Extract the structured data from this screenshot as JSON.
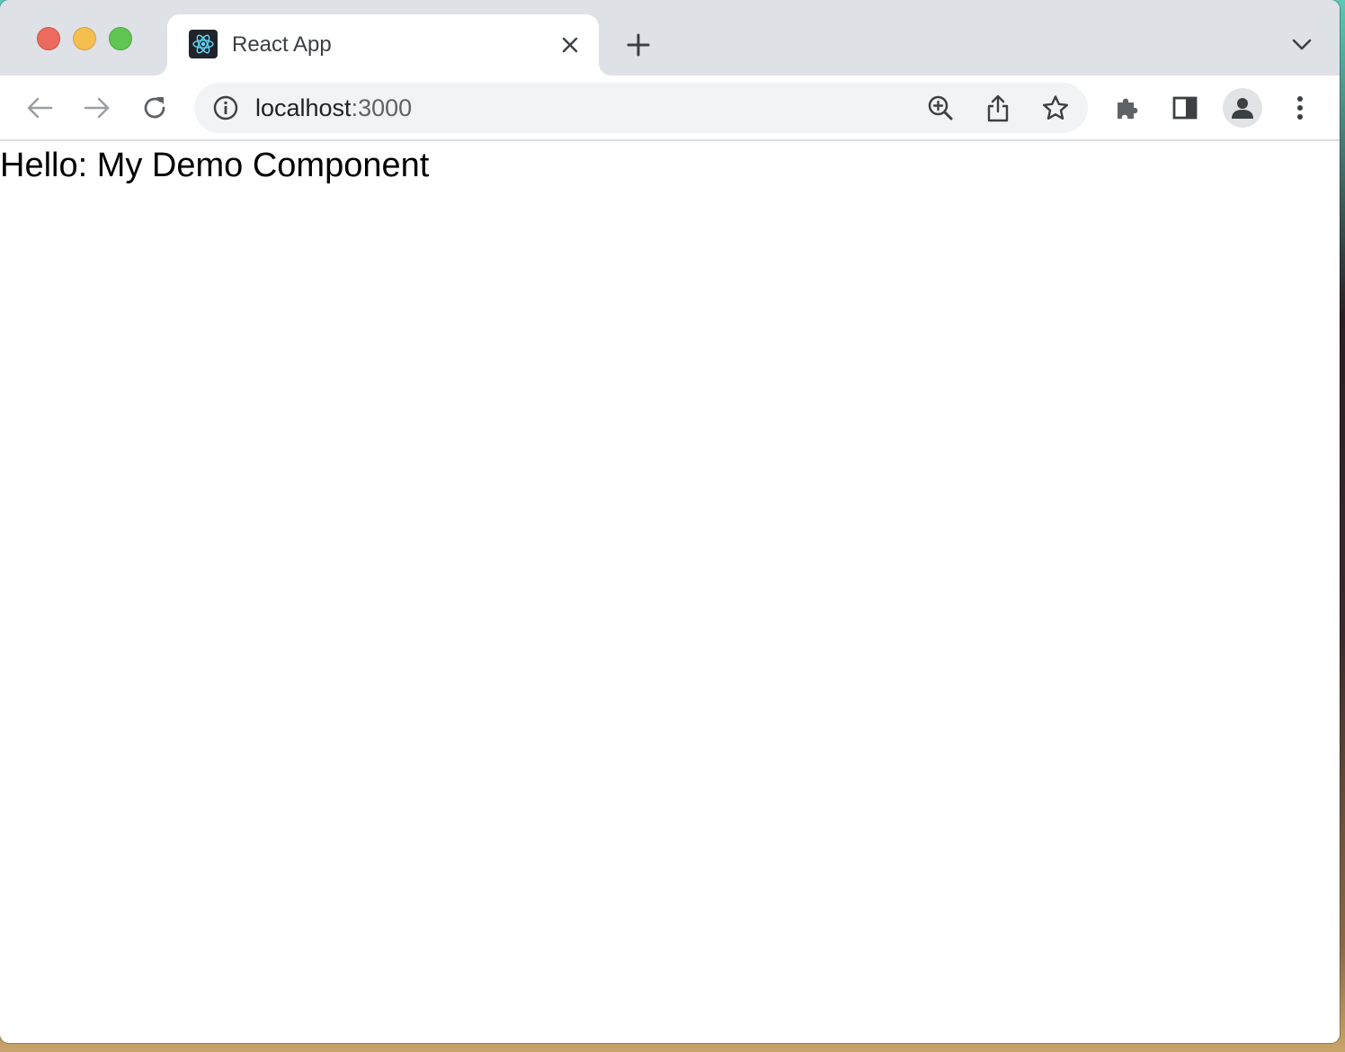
{
  "window": {
    "controls": {
      "close": {
        "color": "#ec6a5e"
      },
      "minimize": {
        "color": "#f4bf4f"
      },
      "zoom": {
        "color": "#61c554"
      }
    }
  },
  "tabs": [
    {
      "title": "React App",
      "favicon": "react-logo-icon",
      "active": true
    }
  ],
  "tab_strip": {
    "new_tab_icon": "plus-icon",
    "tab_search_icon": "chevron-down-icon"
  },
  "toolbar": {
    "back_icon": "arrow-left-icon",
    "forward_icon": "arrow-right-icon",
    "reload_icon": "reload-icon",
    "omnibox": {
      "info_icon": "info-icon",
      "url_host": "localhost",
      "url_port": ":3000",
      "zoom_icon": "zoom-in-icon",
      "share_icon": "share-icon",
      "bookmark_icon": "star-icon"
    },
    "extensions_icon": "puzzle-icon",
    "side_panel_icon": "side-panel-icon",
    "profile_icon": "person-icon",
    "menu_icon": "kebab-menu-icon"
  },
  "page": {
    "text": "Hello: My Demo Component"
  },
  "colors": {
    "tab_strip_bg": "#dee1e6",
    "omnibox_bg": "#f1f3f4",
    "react_accent": "#61dafb",
    "icon_color": "#5f6368"
  }
}
